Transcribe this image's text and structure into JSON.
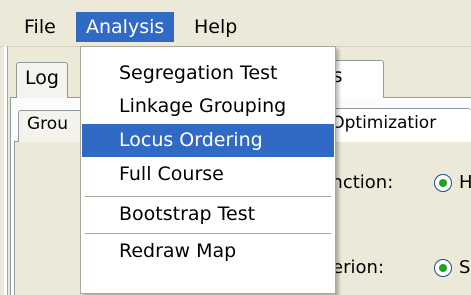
{
  "menubar": {
    "file": "File",
    "analysis": "Analysis",
    "help": "Help"
  },
  "tabs": {
    "log": "Log",
    "options_partial": "ons",
    "groups_partial": "Grou",
    "optimization_partial": "hy Optimizatior"
  },
  "fields": {
    "function_partial": "unction:",
    "criterion_partial": "iterion:",
    "radio1_partial": "H",
    "radio2_partial": "S"
  },
  "analysis_menu": {
    "items": [
      {
        "label": "Segregation Test"
      },
      {
        "label": "Linkage Grouping"
      },
      {
        "label": "Locus Ordering"
      },
      {
        "label": "Full Course"
      },
      {
        "label": "Bootstrap Test"
      },
      {
        "label": "Redraw Map"
      }
    ],
    "highlighted": "Locus Ordering"
  },
  "colors": {
    "highlight": "#316ac5",
    "window_bg": "#ece9d8",
    "radio_dot": "#21a121"
  }
}
